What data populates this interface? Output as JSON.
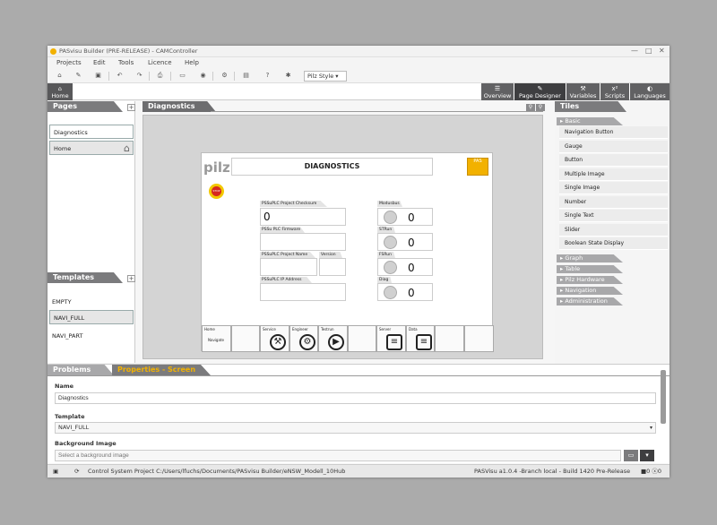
{
  "window": {
    "title": "PASvisu Builder (PRE-RELEASE) - CAMController",
    "minimize": "—",
    "maximize": "□",
    "close": "✕"
  },
  "menu": {
    "items": [
      "Projects",
      "Edit",
      "Tools",
      "Licence",
      "Help"
    ]
  },
  "toolbar": {
    "icons": [
      "home-icon",
      "edit-icon",
      "save-icon",
      "undo-icon",
      "redo-icon",
      "print-icon",
      "monitor-icon",
      "target-icon",
      "network-icon",
      "image-icon",
      "help-icon",
      "settings-icon"
    ],
    "style_select": "Pilz Style"
  },
  "nav": {
    "home_label": "Home",
    "tabs": [
      {
        "label": "Overview",
        "icon": "☰",
        "active": false
      },
      {
        "label": "Page Designer",
        "icon": "✎",
        "active": true
      },
      {
        "label": "Variables",
        "icon": "⚒",
        "active": false
      },
      {
        "label": "Scripts",
        "icon": "x²",
        "active": false
      },
      {
        "label": "Languages",
        "icon": "◐",
        "active": false
      }
    ]
  },
  "pages": {
    "header": "Pages",
    "items": [
      "Diagnostics",
      "Home"
    ]
  },
  "templates": {
    "header": "Templates",
    "items": [
      "EMPTY",
      "NAVI_FULL",
      "NAVI_PART"
    ]
  },
  "canvas": {
    "header": "Diagnostics",
    "screen": {
      "logo": "pilz",
      "title": "DIAGNOSTICS",
      "badge": "PAS",
      "stop_label": "STOP",
      "fields": [
        {
          "label": "PSSuPLC Project Checksum [Dec]",
          "value": "0"
        },
        {
          "label": "PSSu PLC Firmware",
          "value": ""
        },
        {
          "label": "PSSuPLC Project Name",
          "value": ""
        },
        {
          "label": "Version",
          "value": ""
        },
        {
          "label": "PSSuPLC IP Address",
          "value": ""
        }
      ],
      "status": [
        {
          "label": "Modusbus",
          "value": "0"
        },
        {
          "label": "STRun",
          "value": "0"
        },
        {
          "label": "FSRun",
          "value": "0"
        },
        {
          "label": "Diag",
          "value": "0"
        }
      ],
      "footer": [
        {
          "label": "Home",
          "sub": "Navigate",
          "icon": ""
        },
        {
          "label": "",
          "sub": "",
          "icon": ""
        },
        {
          "label": "Service",
          "sub": "",
          "icon": "⚒"
        },
        {
          "label": "Engineer",
          "sub": "",
          "icon": "⚙"
        },
        {
          "label": "Testrun",
          "sub": "",
          "icon": "▶"
        },
        {
          "label": "",
          "sub": "",
          "icon": ""
        },
        {
          "label": "Server",
          "sub": "",
          "icon": "≡"
        },
        {
          "label": "Data",
          "sub": "",
          "icon": "≡"
        },
        {
          "label": "",
          "sub": "",
          "icon": ""
        },
        {
          "label": "",
          "sub": "",
          "icon": ""
        }
      ]
    }
  },
  "tiles": {
    "header": "Tiles",
    "basic": "Basic",
    "items": [
      "Navigation Button",
      "Gauge",
      "Button",
      "Multiple Image",
      "Single Image",
      "Number",
      "Single Text",
      "Slider",
      "Boolean State Display"
    ],
    "categories": [
      "Graph",
      "Table",
      "Pilz Hardware",
      "Navigation",
      "Administration"
    ]
  },
  "bottom": {
    "tabs": [
      "Problems",
      "Properties - Screen"
    ],
    "name_label": "Name",
    "name_value": "Diagnostics",
    "template_label": "Template",
    "template_value": "NAVI_FULL",
    "bg_label": "Background Image",
    "bg_placeholder": "Select a background image"
  },
  "status": {
    "project": "Control System Project C:/Users/lfuchs/Documents/PASvisu Builder/eNSW_Modell_10Hub",
    "version": "PASVisu a1.0.4 -Branch local - Build 1420 Pre-Release",
    "counts": "■0 ⓧ0"
  },
  "colors": {
    "accent": "#f2b100",
    "panel_header": "#7b7b7d",
    "nav_active": "#3e3e40"
  }
}
